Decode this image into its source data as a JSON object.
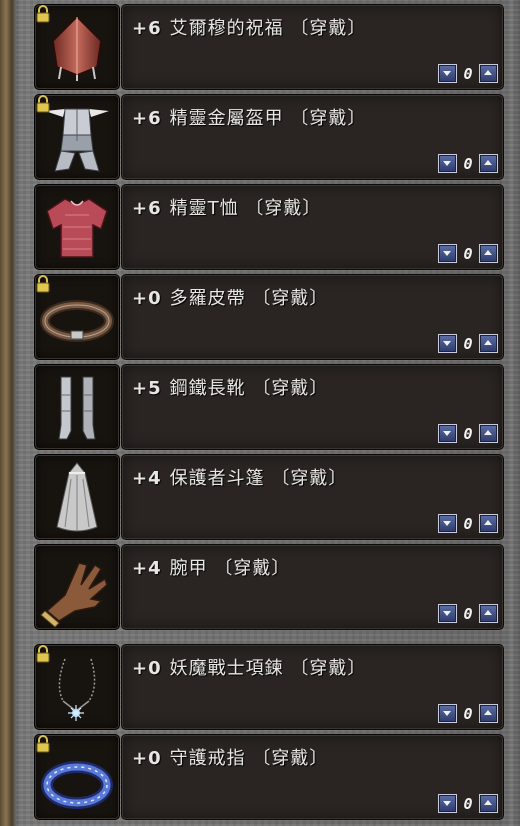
{
  "items": [
    {
      "enchant": "+6",
      "name": "艾爾穆的祝福",
      "status": "〔穿戴〕",
      "count": "0",
      "icon": "cloak-icon",
      "locked": true
    },
    {
      "enchant": "+6",
      "name": "精靈金屬盔甲",
      "status": "〔穿戴〕",
      "count": "0",
      "icon": "plate-armor-icon",
      "locked": true
    },
    {
      "enchant": "+6",
      "name": "精靈T恤",
      "status": "〔穿戴〕",
      "count": "0",
      "icon": "tshirt-icon",
      "locked": false
    },
    {
      "enchant": "+0",
      "name": "多羅皮帶",
      "status": "〔穿戴〕",
      "count": "0",
      "icon": "belt-icon",
      "locked": true
    },
    {
      "enchant": "+5",
      "name": "鋼鐵長靴",
      "status": "〔穿戴〕",
      "count": "0",
      "icon": "boots-icon",
      "locked": false
    },
    {
      "enchant": "+4",
      "name": "保護者斗篷",
      "status": "〔穿戴〕",
      "count": "0",
      "icon": "cape-icon",
      "locked": false
    },
    {
      "enchant": "+4",
      "name": "腕甲",
      "status": "〔穿戴〕",
      "count": "0",
      "icon": "glove-icon",
      "locked": false
    },
    {
      "enchant": "+0",
      "name": "妖魔戰士項鍊",
      "status": "〔穿戴〕",
      "count": "0",
      "icon": "necklace-icon",
      "locked": true
    },
    {
      "enchant": "+0",
      "name": "守護戒指",
      "status": "〔穿戴〕",
      "count": "0",
      "icon": "ring-icon",
      "locked": true
    }
  ]
}
